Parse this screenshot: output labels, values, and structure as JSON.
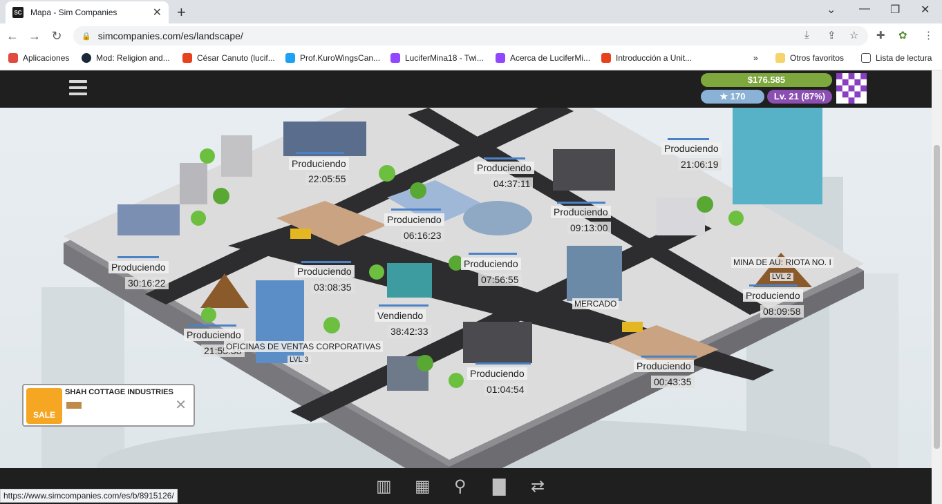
{
  "browser": {
    "tab_title": "Mapa - Sim Companies",
    "favicon_text": "SC",
    "url": "simcompanies.com/es/landscape/",
    "status_url": "https://www.simcompanies.com/es/b/8915126/"
  },
  "bookmarks": [
    {
      "label": "Aplicaciones",
      "color": "#e04a3f"
    },
    {
      "label": "Mod: Religion and...",
      "color": "#1b2838"
    },
    {
      "label": "César Canuto (lucif...",
      "color": "#e8411d"
    },
    {
      "label": "Prof.KuroWingsCan...",
      "color": "#1da1f2"
    },
    {
      "label": "LuciferMina18 - Twi...",
      "color": "#9146ff"
    },
    {
      "label": "Acerca de LuciferMi...",
      "color": "#9146ff"
    },
    {
      "label": "Introducción a Unit...",
      "color": "#e8411d"
    }
  ],
  "bookmarks_right": {
    "more": "»",
    "other": "Otros favoritos",
    "reading": "Lista de lectura"
  },
  "game": {
    "money": "$176.585",
    "stars": "170",
    "level": "Lv. 21 (87%)"
  },
  "buildings": [
    {
      "status": "Produciendo",
      "time": "22:05:55"
    },
    {
      "status": "Produciendo",
      "time": "04:37:11"
    },
    {
      "status": "Produciendo",
      "time": "21:06:19"
    },
    {
      "status": "Produciendo",
      "time": "06:16:23"
    },
    {
      "status": "Produciendo",
      "time": "09:13:00"
    },
    {
      "status": "Produciendo",
      "time": "30:16:22"
    },
    {
      "status": "Produciendo",
      "time": "03:08:35"
    },
    {
      "status": "Produciendo",
      "time": "07:56:55"
    },
    {
      "status": "Vendiendo",
      "time": "38:42:33"
    },
    {
      "status": "Produciendo",
      "time": "21:55:38"
    },
    {
      "status": "Produciendo",
      "time": "01:04:54"
    },
    {
      "status": "Produciendo",
      "time": "08:09:58"
    },
    {
      "status": "Produciendo",
      "time": "00:43:35"
    }
  ],
  "named": {
    "mine": "MINA DE AU: RIOTA NO. I",
    "mine_lvl": "LVL 2",
    "market": "MERCADO",
    "offices": "OFICINAS DE VENTAS CORPORATIVAS",
    "offices_lvl": "LVL 3"
  },
  "promo": {
    "name": "SHAH COTTAGE INDUSTRIES",
    "badge": "SALE"
  }
}
